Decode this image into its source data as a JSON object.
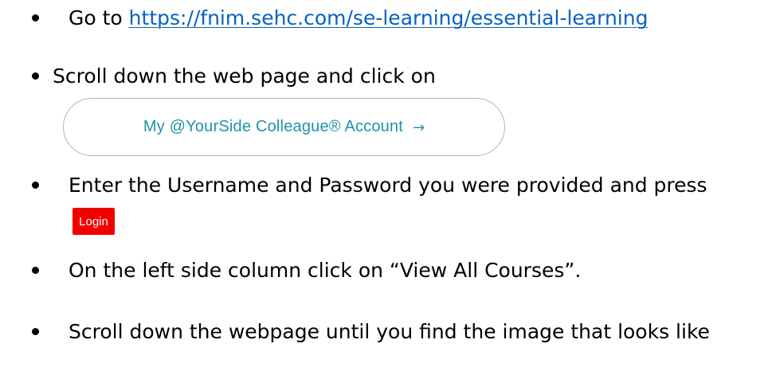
{
  "steps": [
    {
      "prefix": "Go to ",
      "link": "https://fnim.sehc.com/se-learning/essential-learning"
    },
    {
      "text": "Scroll down the web page and click on"
    },
    {
      "text": "Enter the Username and Password you were provided and press"
    },
    {
      "text": "On the left side column click on “View All Courses”."
    },
    {
      "text": "Scroll down the webpage until you find the image that looks like"
    }
  ],
  "account_button": {
    "label": "My @YourSide Colleague® Account",
    "arrow": "→",
    "text_color": "#1d93a9"
  },
  "login_button": {
    "label": "Login",
    "background": "#f20000"
  },
  "colors": {
    "link": "#0563c1",
    "text": "#000000"
  }
}
